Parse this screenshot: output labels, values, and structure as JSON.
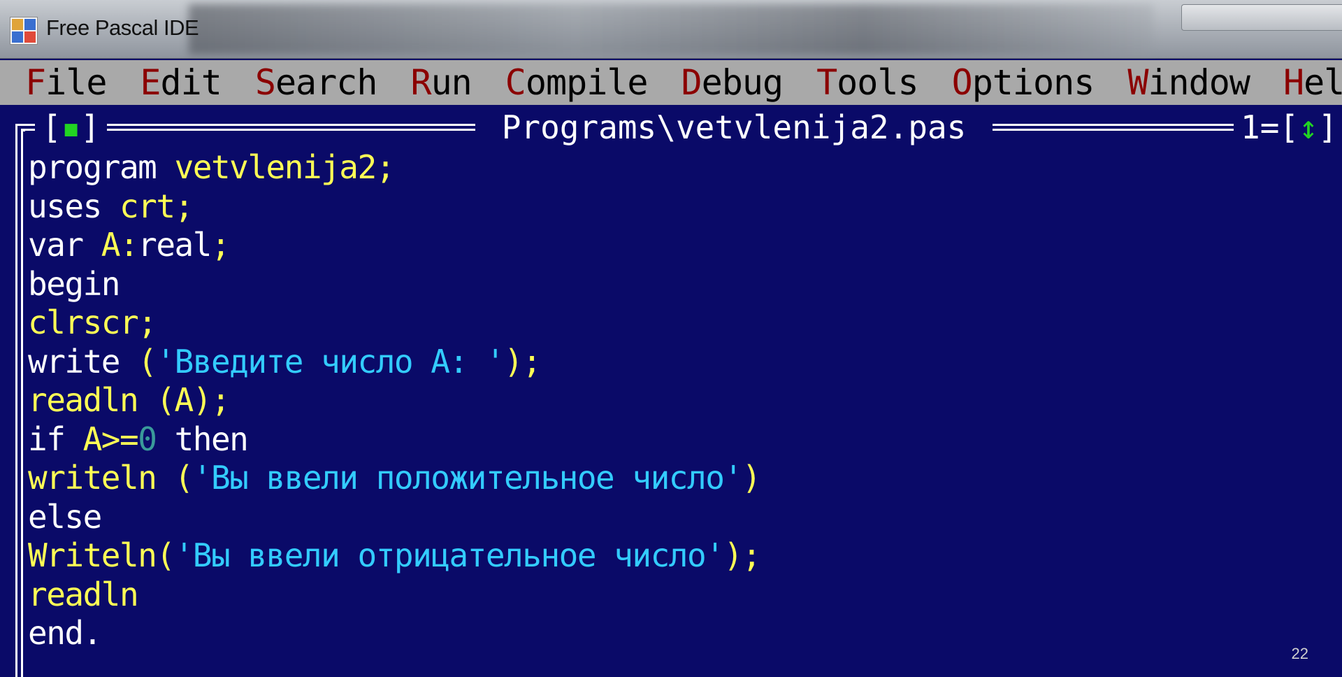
{
  "window": {
    "title": "Free Pascal IDE",
    "icon": "free-pascal-ide-icon"
  },
  "menu": {
    "items": [
      {
        "hot": "F",
        "rest": "ile"
      },
      {
        "hot": "E",
        "rest": "dit"
      },
      {
        "hot": "S",
        "rest": "earch"
      },
      {
        "hot": "R",
        "rest": "un"
      },
      {
        "hot": "C",
        "rest": "ompile"
      },
      {
        "hot": "D",
        "rest": "ebug"
      },
      {
        "hot": "T",
        "rest": "ools"
      },
      {
        "hot": "O",
        "rest": "ptions"
      },
      {
        "hot": "W",
        "rest": "indow"
      },
      {
        "hot": "H",
        "rest": "elp"
      }
    ]
  },
  "editor": {
    "close_box_open": "[",
    "close_box_dot": "▪",
    "close_box_close": "]",
    "file_title": " Programs\\vetvlenija2.pas ",
    "window_number": "1",
    "zoom_open": "[",
    "zoom_arrow": "↕",
    "zoom_close": "]",
    "code_lines": [
      [
        {
          "t": "program ",
          "c": "w"
        },
        {
          "t": "vetvlenija2;",
          "c": "y"
        }
      ],
      [
        {
          "t": "uses ",
          "c": "w"
        },
        {
          "t": "crt;",
          "c": "y"
        }
      ],
      [
        {
          "t": "var ",
          "c": "w"
        },
        {
          "t": "A:",
          "c": "y"
        },
        {
          "t": "real",
          "c": "w"
        },
        {
          "t": ";",
          "c": "y"
        }
      ],
      [
        {
          "t": "begin",
          "c": "w"
        }
      ],
      [
        {
          "t": "clrscr;",
          "c": "y"
        }
      ],
      [
        {
          "t": "write ",
          "c": "w"
        },
        {
          "t": "(",
          "c": "y"
        },
        {
          "t": "'Введите число A: '",
          "c": "c"
        },
        {
          "t": ");",
          "c": "y"
        }
      ],
      [
        {
          "t": "readln (A);",
          "c": "y"
        }
      ],
      [
        {
          "t": "if ",
          "c": "w"
        },
        {
          "t": "A>=",
          "c": "y"
        },
        {
          "t": "0",
          "c": "g"
        },
        {
          "t": " then",
          "c": "w"
        }
      ],
      [
        {
          "t": "writeln (",
          "c": "y"
        },
        {
          "t": "'Вы ввели положительное число'",
          "c": "c"
        },
        {
          "t": ")",
          "c": "y"
        }
      ],
      [
        {
          "t": "else",
          "c": "w"
        }
      ],
      [
        {
          "t": "Writeln(",
          "c": "y"
        },
        {
          "t": "'Вы ввели отрицательное число'",
          "c": "c"
        },
        {
          "t": ");",
          "c": "y"
        }
      ],
      [
        {
          "t": "readln",
          "c": "y"
        }
      ],
      [
        {
          "t": "end.",
          "c": "w"
        }
      ]
    ]
  },
  "slide": {
    "page_number": "22"
  },
  "colors": {
    "editor_background": "#0a0a68",
    "menu_background": "#a9a9a9",
    "menu_hotkey": "#8b0000",
    "keyword": "#ffffff",
    "identifier": "#ffff55",
    "string": "#33ccff",
    "number": "#3a9a9a"
  }
}
